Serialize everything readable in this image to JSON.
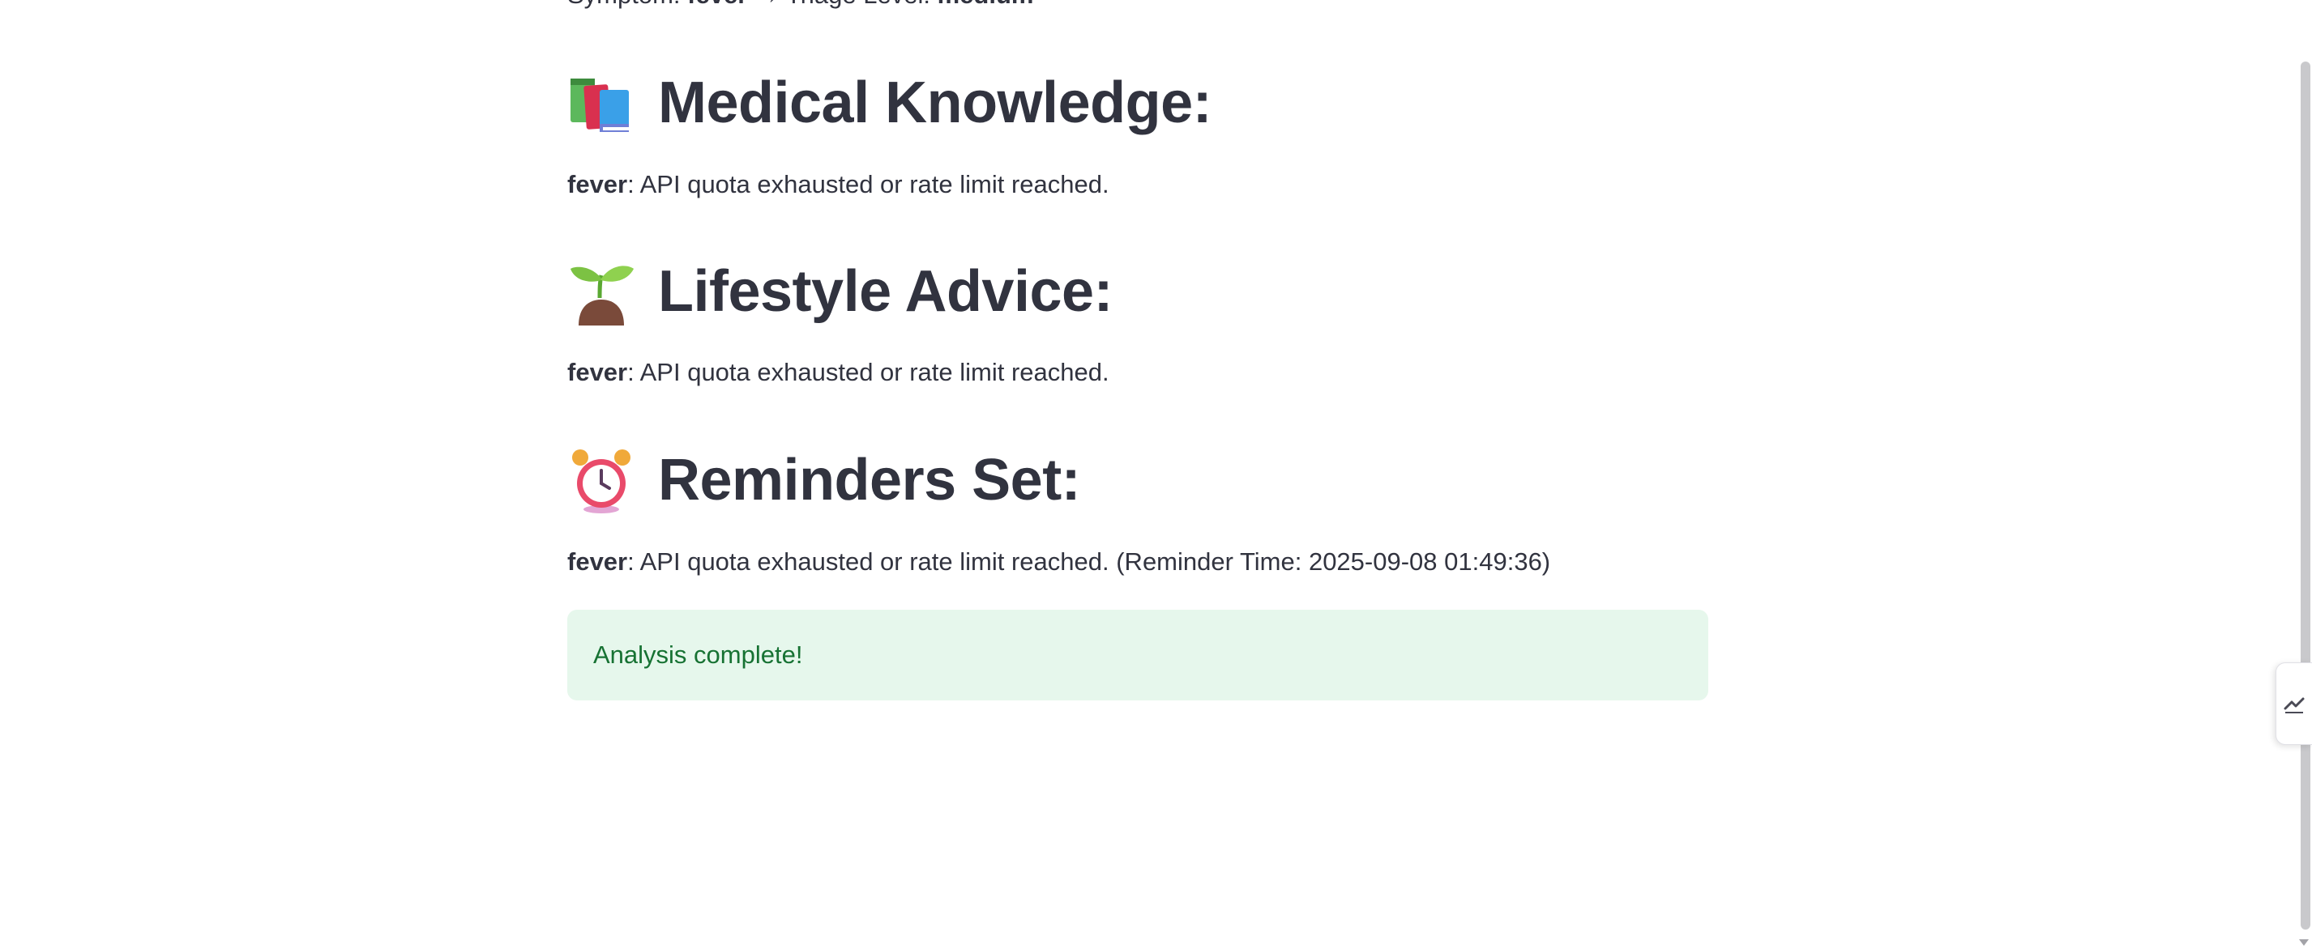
{
  "header_line": {
    "symptom_label": "Symptom: ",
    "symptom_value": "fever",
    "arrow": " → ",
    "triage_label": "Triage Level: ",
    "triage_value": "medium"
  },
  "sections": [
    {
      "icon": "books-icon",
      "title": "Medical Knowledge:",
      "term": "fever",
      "text": ": API quota exhausted or rate limit reached."
    },
    {
      "icon": "seedling-icon",
      "title": "Lifestyle Advice:",
      "term": "fever",
      "text": ": API quota exhausted or rate limit reached."
    },
    {
      "icon": "alarm-clock-icon",
      "title": "Reminders Set:",
      "term": "fever",
      "text": ": API quota exhausted or rate limit reached. (Reminder Time: 2025-09-08 01:49:36)"
    }
  ],
  "alert": {
    "message": "Analysis complete!",
    "background": "#e6f7ec",
    "text_color": "#177233"
  },
  "side_tab": {
    "icon": "chart-toggle-icon"
  }
}
